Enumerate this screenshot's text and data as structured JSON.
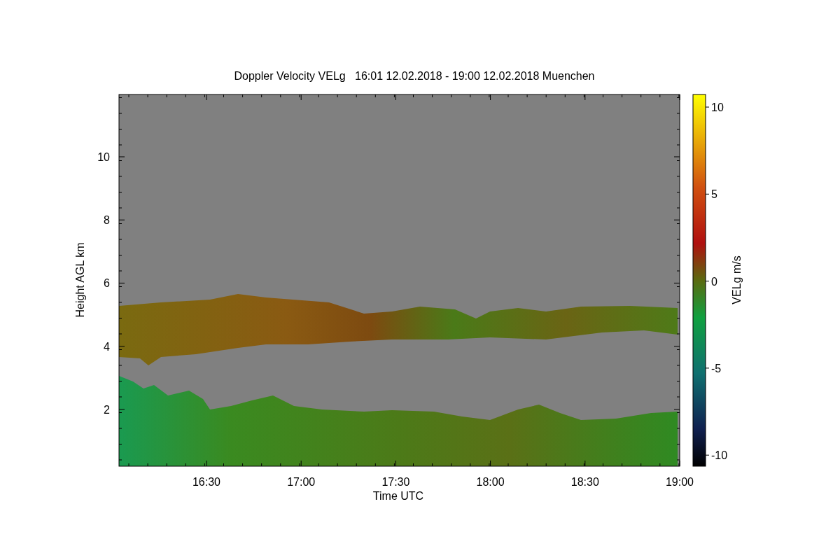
{
  "plot": {
    "title": "Doppler Velocity VELg   16:01 12.02.2018 - 19:00 12.02.2018 Muenchen",
    "ylabel": "Height AGL km",
    "xlabel": "Time UTC",
    "yticks": [
      "10",
      "8",
      "6",
      "4",
      "2"
    ],
    "xticks": [
      "16:30",
      "17:00",
      "17:30",
      "18:00",
      "18:30",
      "19:00"
    ]
  },
  "colorbar": {
    "label": "VELg m/s",
    "ticks": [
      "10",
      "5",
      "0",
      "-5",
      "-10"
    ]
  }
}
